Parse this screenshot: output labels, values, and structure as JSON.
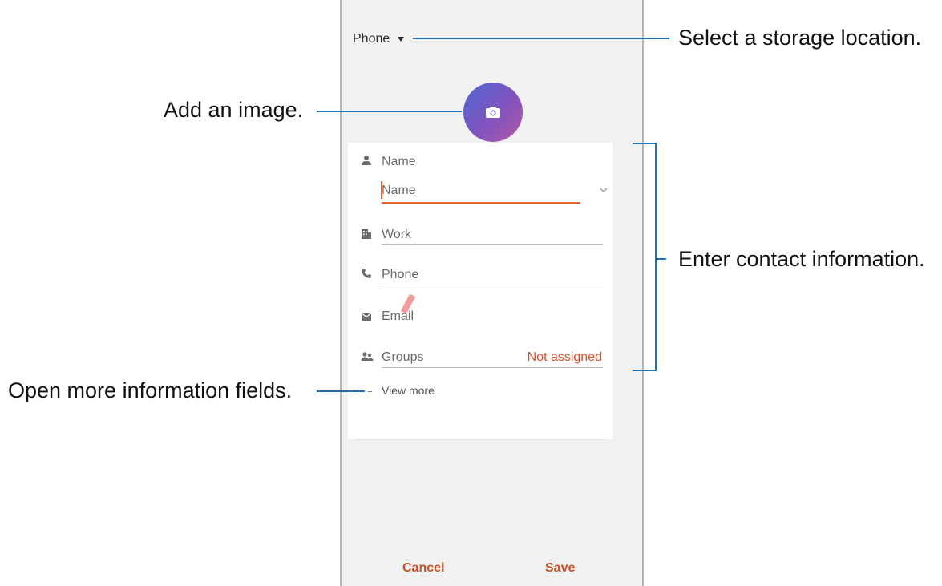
{
  "screen": {
    "storage_label": "Phone",
    "fields": {
      "name_label": "Name",
      "name_placeholder": "Name",
      "work_label": "Work",
      "phone_label": "Phone",
      "email_label": "Email",
      "groups_label": "Groups",
      "groups_value": "Not assigned"
    },
    "view_more": "View more",
    "buttons": {
      "cancel": "Cancel",
      "save": "Save"
    }
  },
  "callouts": {
    "storage": "Select a storage location.",
    "image": "Add an image.",
    "contact": "Enter contact information.",
    "more_fields": "Open more information fields."
  },
  "colors": {
    "accent": "#e0642e",
    "callout_line": "#1e6fb4",
    "camera_gradient_start": "#4d67d6",
    "camera_gradient_end": "#b25aa6"
  },
  "icons": {
    "storage_dropdown": "caret-down-icon",
    "add_image": "camera-icon",
    "name": "person-icon",
    "name_expand": "chevron-down-icon",
    "work": "building-icon",
    "phone": "phone-icon",
    "email": "envelope-icon",
    "groups": "people-icon"
  }
}
